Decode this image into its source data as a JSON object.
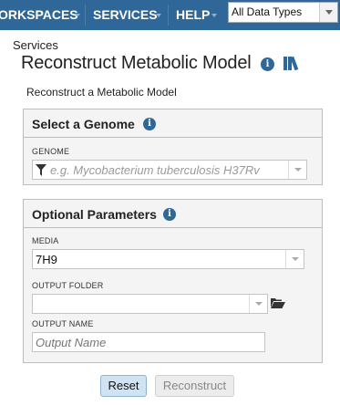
{
  "topnav": {
    "items": [
      {
        "label": "ORKSPACES"
      },
      {
        "label": "SERVICES"
      },
      {
        "label": "HELP"
      }
    ],
    "data_type_select": {
      "value": "All Data Types"
    }
  },
  "breadcrumb": "Services",
  "page_title": "Reconstruct Metabolic Model",
  "subtitle": "Reconstruct a Metabolic Model",
  "genome_panel": {
    "title": "Select a Genome",
    "genome_label": "GENOME",
    "genome_placeholder": "e.g. Mycobacterium tuberculosis H37Rv"
  },
  "optional_panel": {
    "title": "Optional Parameters",
    "media_label": "MEDIA",
    "media_value": "7H9",
    "output_folder_label": "OUTPUT FOLDER",
    "output_folder_value": "",
    "output_name_label": "OUTPUT NAME",
    "output_name_placeholder": "Output Name"
  },
  "buttons": {
    "reset": "Reset",
    "reconstruct": "Reconstruct"
  },
  "colors": {
    "nav_bg": "#2e6798",
    "panel_bg": "#f4f4f4",
    "reset_bg": "#cfe3f4"
  },
  "icons": [
    "info-icon",
    "library-icon",
    "filter-icon",
    "folder-open-icon",
    "chevron-down-icon"
  ]
}
